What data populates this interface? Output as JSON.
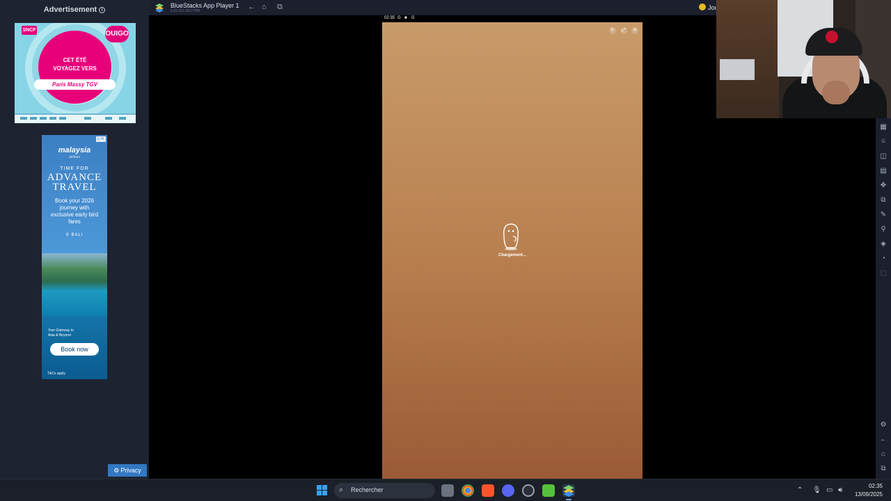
{
  "ad_panel": {
    "header": "Advertisement",
    "ad1": {
      "brand_left": "SNCF",
      "brand_right": "OUIGO",
      "tagline_1": "CET ÉTÉ",
      "tagline_2": "VOYAGEZ VERS",
      "destination": "Paris Massy TGV"
    },
    "ad2": {
      "logo": "malaysia",
      "logo_sub": "airlines",
      "headline_1": "TIME FOR",
      "headline_2": "ADVANCE",
      "headline_3": "TRAVEL",
      "body": "Book your 2026 journey with exclusive early bird fares",
      "location": "BALI",
      "gateway": "Your Gateway to Asia & Beyond",
      "cta": "Book now",
      "terms": "T&Cs apply"
    },
    "privacy_label": "Privacy"
  },
  "bluestacks": {
    "title": "BlueStacks App Player 1",
    "version": "5.22.101.2017  P64",
    "right_label": "Jou"
  },
  "phone": {
    "time": "02:35",
    "loading_text": "Chargement..."
  },
  "taskbar": {
    "search_placeholder": "Rechercher",
    "time": "02:35",
    "date": "13/09/2025"
  },
  "colors": {
    "panel_bg": "#1d2331",
    "titlebar_bg": "#1b1f2e",
    "phone_top": "#c89b6a",
    "phone_bottom": "#9b5a36",
    "taskbar_bg": "#1b2028",
    "ouigo_pink": "#e7007a",
    "privacy_blue": "#3278c2"
  }
}
